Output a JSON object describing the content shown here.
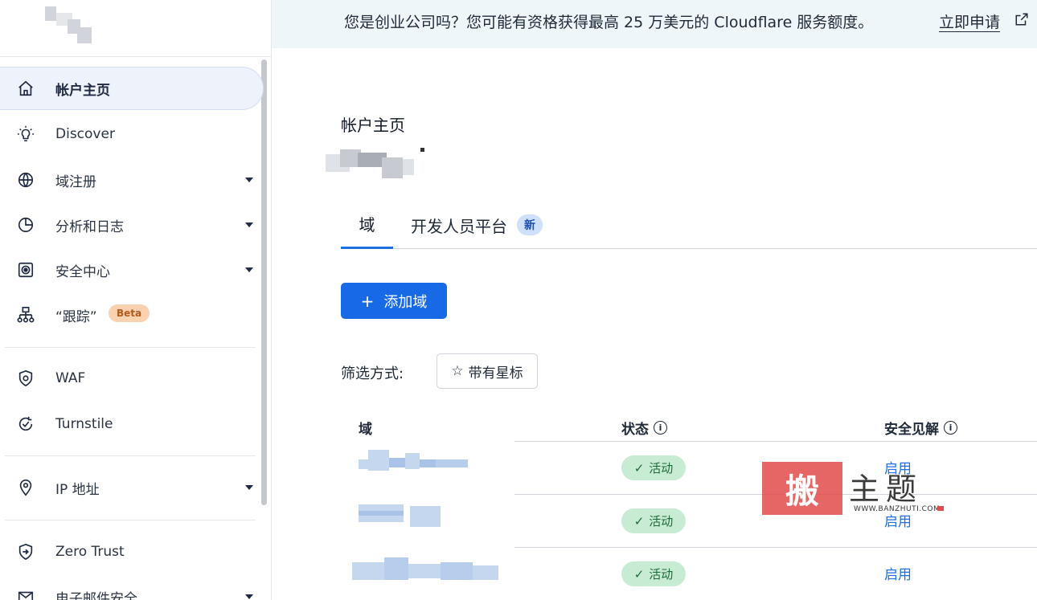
{
  "sidebar": {
    "items": [
      {
        "label": "帐户主页",
        "icon": "home-icon",
        "active": true
      },
      {
        "label": "Discover",
        "icon": "lightbulb-icon"
      },
      {
        "label": "域注册",
        "icon": "globe-icon",
        "expandable": true
      },
      {
        "label": "分析和日志",
        "icon": "pie-chart-icon",
        "expandable": true
      },
      {
        "label": "安全中心",
        "icon": "security-center-icon",
        "expandable": true
      },
      {
        "label": "“跟踪”",
        "icon": "sitemap-icon",
        "badge": "Beta"
      },
      {
        "label": "WAF",
        "icon": "shield-icon"
      },
      {
        "label": "Turnstile",
        "icon": "turnstile-icon"
      },
      {
        "label": "IP 地址",
        "icon": "location-pin-icon",
        "expandable": true
      },
      {
        "label": "Zero Trust",
        "icon": "zero-trust-icon"
      },
      {
        "label": "电子邮件安全",
        "icon": "mail-icon",
        "expandable": true
      }
    ]
  },
  "banner": {
    "text": "您是创业公司吗？您可能有资格获得最高 25 万美元的 Cloudflare 服务额度。",
    "link": "立即申请"
  },
  "main": {
    "title": "帐户主页",
    "tabs": [
      {
        "label": "域",
        "active": true
      },
      {
        "label": "开发人员平台",
        "badge": "新"
      }
    ],
    "add_button": "添加域",
    "filter_label": "筛选方式:",
    "filter_button": "带有星标",
    "table": {
      "headers": [
        "域",
        "状态",
        "安全见解"
      ],
      "rows": [
        {
          "status": "活动",
          "insight": "启用"
        },
        {
          "status": "活动",
          "insight": "启用"
        },
        {
          "status": "活动",
          "insight": "启用"
        }
      ]
    }
  },
  "watermark": {
    "seal": "搬",
    "text": "主题",
    "url": "WWW.BANZHUTI.COM"
  },
  "colors": {
    "accent": "#1769e6",
    "banner_bg": "#eef6fa",
    "status_bg": "#c7ecd3",
    "status_fg": "#1f6a3a",
    "beta_bg": "#fbd2b0"
  }
}
